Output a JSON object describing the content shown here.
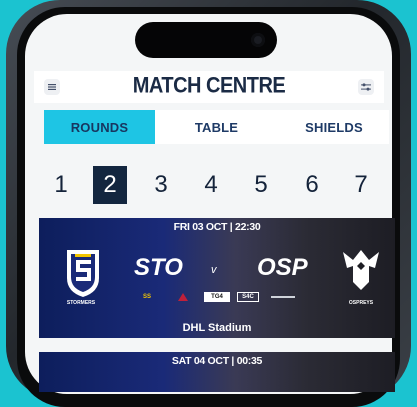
{
  "header": {
    "title": "MATCH CENTRE"
  },
  "tabs": [
    {
      "label": "ROUNDS",
      "active": true
    },
    {
      "label": "TABLE",
      "active": false
    },
    {
      "label": "SHIELDS",
      "active": false
    }
  ],
  "rounds": {
    "numbers": [
      "1",
      "2",
      "3",
      "4",
      "5",
      "6",
      "7"
    ],
    "selected": "2"
  },
  "matches": [
    {
      "datetime": "FRI 03 OCT | 22:30",
      "home": {
        "code": "STO",
        "name": "STORMERS",
        "color": "#1a2a78"
      },
      "vs": "v",
      "away": {
        "code": "OSP",
        "name": "OSPREYS",
        "color": "#1d1d24"
      },
      "broadcasters": [
        "SS",
        "TG4",
        "S4C"
      ],
      "venue": "DHL Stadium"
    },
    {
      "datetime": "SAT 04 OCT | 00:35"
    }
  ],
  "colors": {
    "background": "#1bc3d0",
    "accent": "#1ec5e4",
    "navy": "#13263f"
  }
}
